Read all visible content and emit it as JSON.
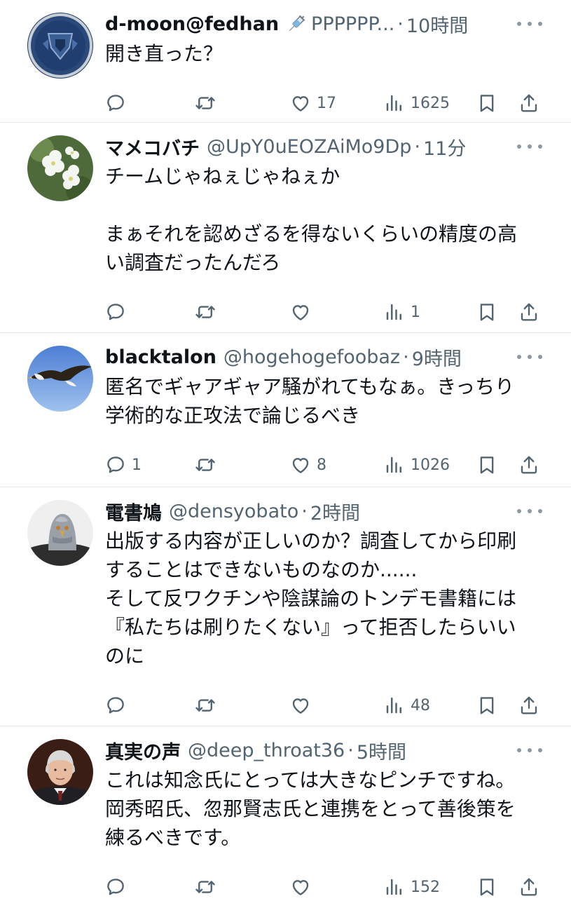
{
  "feed": {
    "posts": [
      {
        "display_name": "d-moon@fedhan",
        "handle": "PPPPPP...",
        "separator": "·",
        "time": "10時間",
        "body_lines": [
          "開き直った？"
        ],
        "replies": "",
        "reposts": "",
        "likes": "17",
        "views": "1625",
        "avatar_icon": "emblem-avatar"
      },
      {
        "display_name": "マメコバチ",
        "handle": "@UpY0uEOZAiMo9Dp",
        "separator": "·",
        "time": "11分",
        "body_lines": [
          "チームじゃねぇじゃねぇか",
          "",
          "まぁそれを認めざるを得ないくらいの精度の高",
          "い調査だったんだろ"
        ],
        "replies": "",
        "reposts": "",
        "likes": "",
        "views": "1",
        "avatar_icon": "white-flowers-avatar"
      },
      {
        "display_name": "blacktalon",
        "handle": "@hogehogefoobaz",
        "separator": "·",
        "time": "9時間",
        "body_lines": [
          "匿名でギャアギャア騒がれてもなぁ。きっちり",
          "学術的な正攻法で論じるべき"
        ],
        "replies": "1",
        "reposts": "",
        "likes": "8",
        "views": "1026",
        "avatar_icon": "eagle-avatar"
      },
      {
        "display_name": "電書鳩",
        "handle": "@densyobato",
        "separator": "·",
        "time": "2時間",
        "body_lines": [
          "出版する内容が正しいのか？調査してから印刷",
          "することはできないものなのか......",
          "そして反ワクチンや陰謀論のトンデモ書籍には",
          "『私たちは刷りたくない』って拒否したらいい",
          "のに"
        ],
        "replies": "",
        "reposts": "",
        "likes": "",
        "views": "48",
        "avatar_icon": "pigeon-mask-avatar"
      },
      {
        "display_name": "真実の声",
        "handle": "@deep_throat36",
        "separator": "·",
        "time": "5時間",
        "body_lines": [
          "これは知念氏にとっては大きなピンチですね。",
          "岡秀昭氏、忽那賢志氏と連携をとって善後策を",
          "練るべきです。"
        ],
        "replies": "",
        "reposts": "",
        "likes": "",
        "views": "152",
        "avatar_icon": "portrait-avatar"
      }
    ]
  },
  "colors": {
    "text": "#0f1419",
    "secondary": "#536471",
    "divider": "#e7e9eb",
    "icon": "#536471"
  }
}
